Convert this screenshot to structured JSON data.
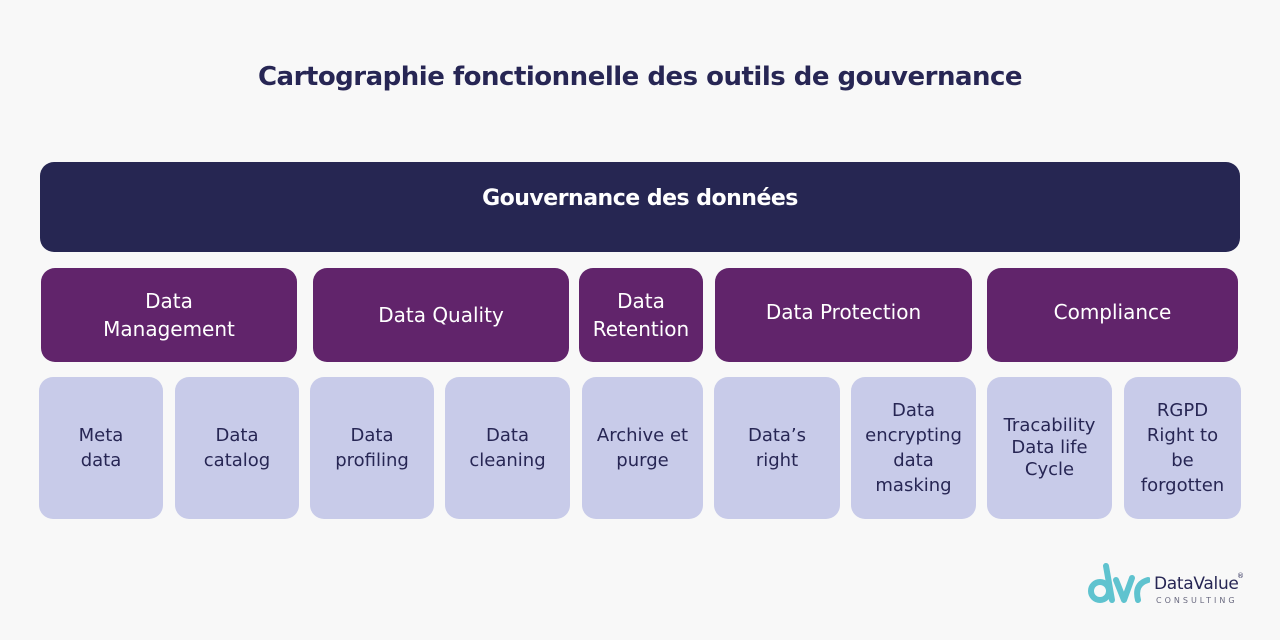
{
  "title": "Cartographie fonctionnelle des outils de gouvernance",
  "banner": {
    "label": "Gouvernance des données",
    "color": "#262652"
  },
  "categories": [
    {
      "label": "Data\nManagement"
    },
    {
      "label": "Data Quality"
    },
    {
      "label": "Data\nRetention"
    },
    {
      "label": "Data Protection"
    },
    {
      "label": "Compliance"
    }
  ],
  "tools": [
    {
      "label": "Meta\ndata"
    },
    {
      "label": "Data\ncatalog"
    },
    {
      "label": "Data\nprofiling"
    },
    {
      "label": "Data\ncleaning"
    },
    {
      "label": "Archive et\npurge"
    },
    {
      "label": "Data’s\nright"
    },
    {
      "label": "Data\nencrypting\ndata\nmasking"
    },
    {
      "label": "Tracability\nData life\nCycle"
    },
    {
      "label": "RGPD\nRight to\nbe\nforgotten"
    }
  ],
  "colors": {
    "category": "#61246b",
    "tool": "#c8cbe9",
    "text_dark": "#272654",
    "logo_accent": "#5fc3cf"
  },
  "logo": {
    "name": "DataValue",
    "registered": "®",
    "subtitle": "CONSULTING",
    "icon": "dvc-logo-icon"
  }
}
